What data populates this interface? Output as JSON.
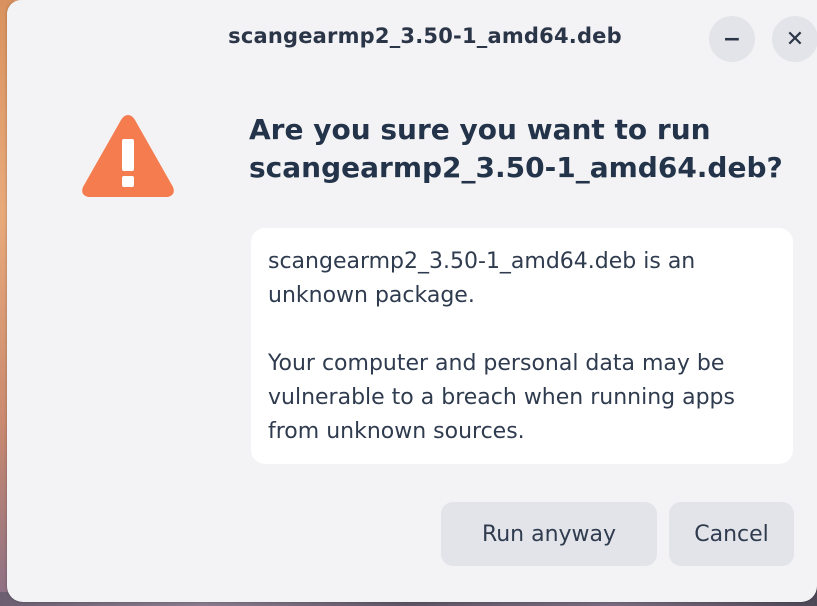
{
  "window": {
    "title": "scangearmp2_3.50-1_amd64.deb",
    "minimize_symbol": "−",
    "close_symbol": "✕"
  },
  "warning": {
    "icon": "warning-triangle-icon",
    "color": "#f47c4f",
    "headline": "Are you sure you want to run scangearmp2_3.50-1_amd64.deb?"
  },
  "message": {
    "paragraph1": "scangearmp2_3.50-1_amd64.deb is an unknown package.",
    "paragraph2": "Your computer and personal data may be vulnerable to a breach when running apps from unknown sources."
  },
  "actions": {
    "run_label": "Run anyway",
    "cancel_label": "Cancel"
  }
}
